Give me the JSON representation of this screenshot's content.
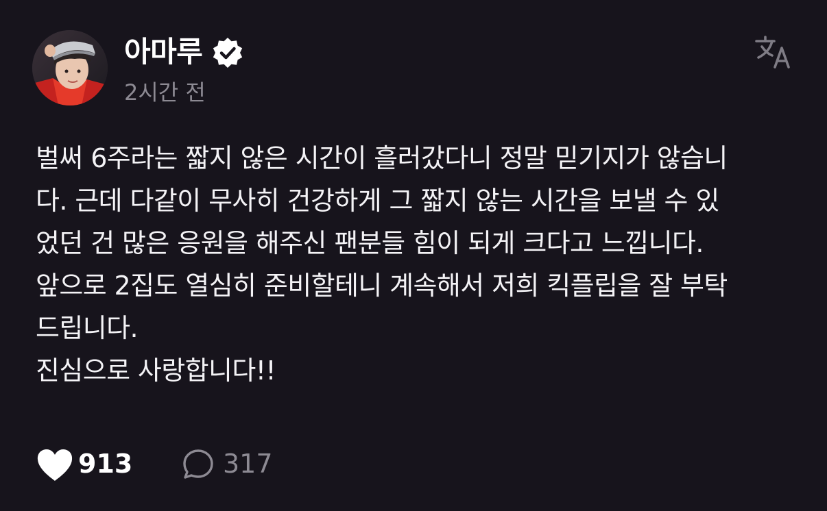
{
  "post": {
    "author": {
      "name": "아마루",
      "verified": true
    },
    "timestamp": "2시간 전",
    "body_lines": [
      "벌써 6주라는 짧지 않은 시간이 흘러갔다니 정말 믿기지가 않습니",
      "다. 근데 다같이 무사히 건강하게 그 짧지 않는 시간을 보낼 수 있",
      "었던 건 많은 응원을 해주신 팬분들 힘이 되게 크다고 느낍니다.",
      "앞으로 2집도 열심히 준비할테니 계속해서 저희 킥플립을 잘 부탁",
      "드립니다.",
      "진심으로 사랑합니다!!"
    ],
    "likes": "913",
    "replies": "317"
  },
  "icons": {
    "avatar": "avatar",
    "verified": "verified-badge-icon",
    "translate": "translate-icon",
    "like": "heart-icon",
    "reply": "comment-bubble-icon"
  },
  "colors": {
    "background": "#17141c",
    "text": "#f4f3f6",
    "muted": "#8d8a93",
    "accent": "#ffffff"
  }
}
